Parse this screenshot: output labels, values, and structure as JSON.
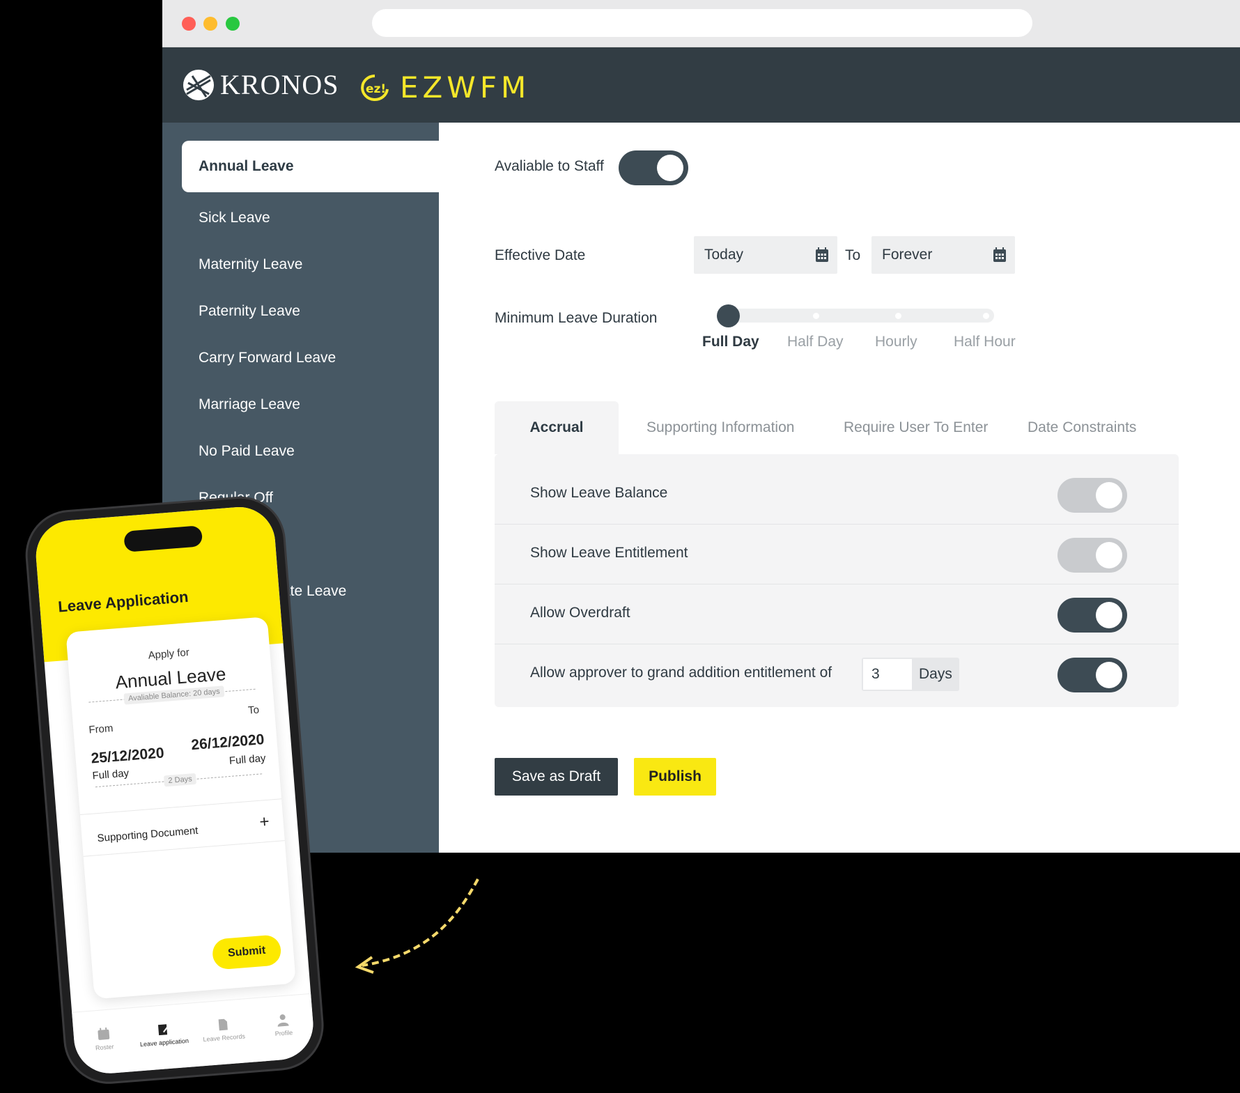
{
  "header": {
    "kronos_logo": "KRONOS",
    "ez_logo": "EZWFM"
  },
  "sidebar": {
    "items": [
      {
        "label": "Annual Leave",
        "active": true
      },
      {
        "label": "Sick Leave"
      },
      {
        "label": "Maternity Leave"
      },
      {
        "label": "Paternity Leave"
      },
      {
        "label": "Carry Forward Leave"
      },
      {
        "label": "Marriage Leave"
      },
      {
        "label": "No Paid Leave"
      },
      {
        "label": "Regular Off"
      },
      {
        "label": "ate Leave"
      }
    ]
  },
  "main": {
    "available_to_staff": {
      "label": "Avaliable to Staff",
      "on": true
    },
    "effective_date": {
      "label": "Effective Date",
      "from": "Today",
      "to_label": "To",
      "to": "Forever"
    },
    "min_duration": {
      "label": "Minimum Leave Duration",
      "options": [
        "Full Day",
        "Half Day",
        "Hourly",
        "Half Hour"
      ],
      "selected": "Full Day"
    },
    "tabs": [
      {
        "label": "Accrual",
        "active": true
      },
      {
        "label": "Supporting Information"
      },
      {
        "label": "Require User To Enter"
      },
      {
        "label": "Date Constraints"
      }
    ],
    "accrual_rows": [
      {
        "label": "Show Leave Balance",
        "on": false
      },
      {
        "label": "Show Leave Entitlement",
        "on": false
      },
      {
        "label": "Allow Overdraft",
        "on": true
      },
      {
        "label": "Allow approver to grand addition entitlement of",
        "on": true,
        "value": "3",
        "unit": "Days"
      }
    ],
    "buttons": {
      "draft": "Save as Draft",
      "publish": "Publish"
    }
  },
  "mobile": {
    "title": "Leave Application",
    "apply_for": "Apply for",
    "leave_type": "Annual Leave",
    "balance": "Avaliable Balance: 20 days",
    "from_label": "From",
    "to_label": "To",
    "from_date": "25/12/2020",
    "from_type": "Full day",
    "to_date": "26/12/2020",
    "to_type": "Full day",
    "duration": "2 Days",
    "supporting_doc": "Supporting Document",
    "submit": "Submit",
    "nav": [
      "Roster",
      "Leave application",
      "Leave Records",
      "Profile"
    ]
  },
  "colors": {
    "dark": "#323d44",
    "sidebar": "#475864",
    "accent_yellow": "#f9e812"
  }
}
